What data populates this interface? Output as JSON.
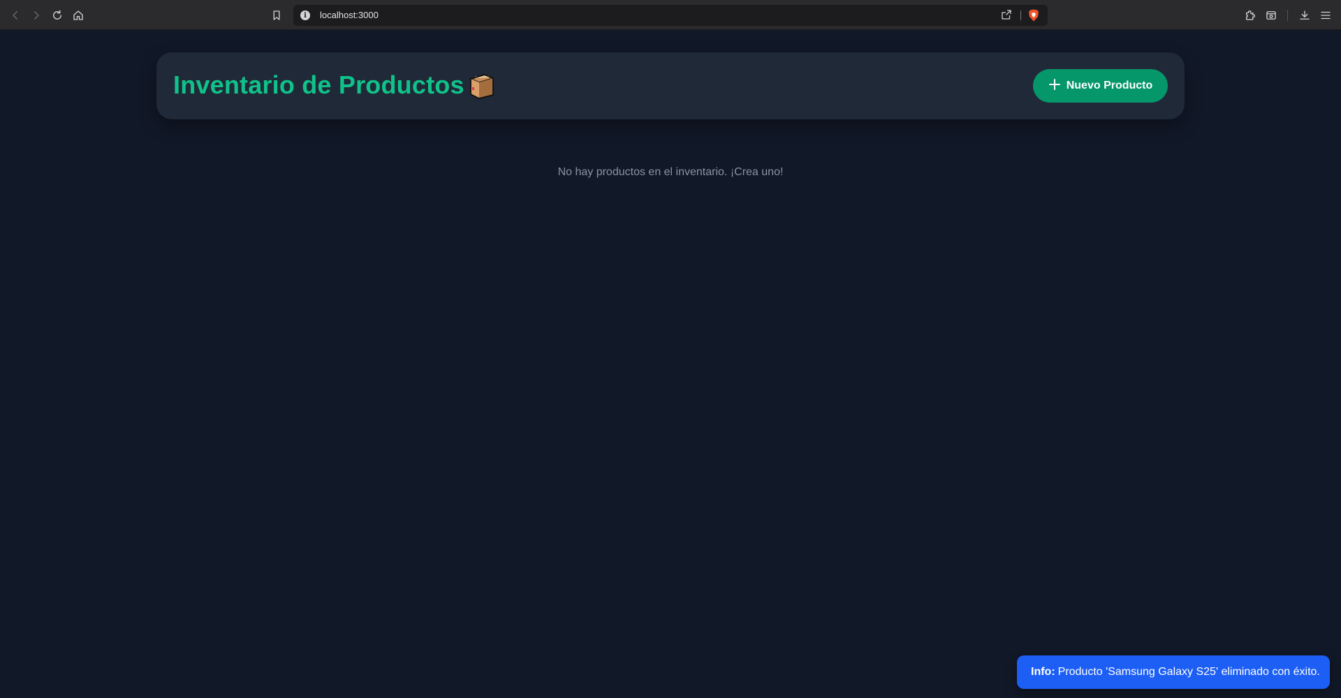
{
  "browser": {
    "url": "localhost:3000",
    "toolbar_icons": [
      "back-icon",
      "forward-icon",
      "reload-icon",
      "home-icon",
      "bookmark-icon",
      "site-info-icon",
      "share-icon",
      "brave-shield-icon",
      "extensions-icon",
      "reader-mode-icon",
      "download-icon",
      "menu-icon"
    ]
  },
  "header": {
    "title": "Inventario de Productos",
    "title_emoji_icon": "package-box-icon",
    "new_button_label": "Nuevo Producto",
    "new_button_icon": "plus-icon"
  },
  "main": {
    "empty_message": "No hay productos en el inventario. ¡Crea uno!"
  },
  "toast": {
    "label": "Info:",
    "message": "Producto 'Samsung Galaxy S25' eliminado con éxito."
  },
  "colors": {
    "background": "#111827",
    "card": "#1f2937",
    "accent": "#10c28a",
    "button": "#059669",
    "toast": "#1d5ff5"
  }
}
